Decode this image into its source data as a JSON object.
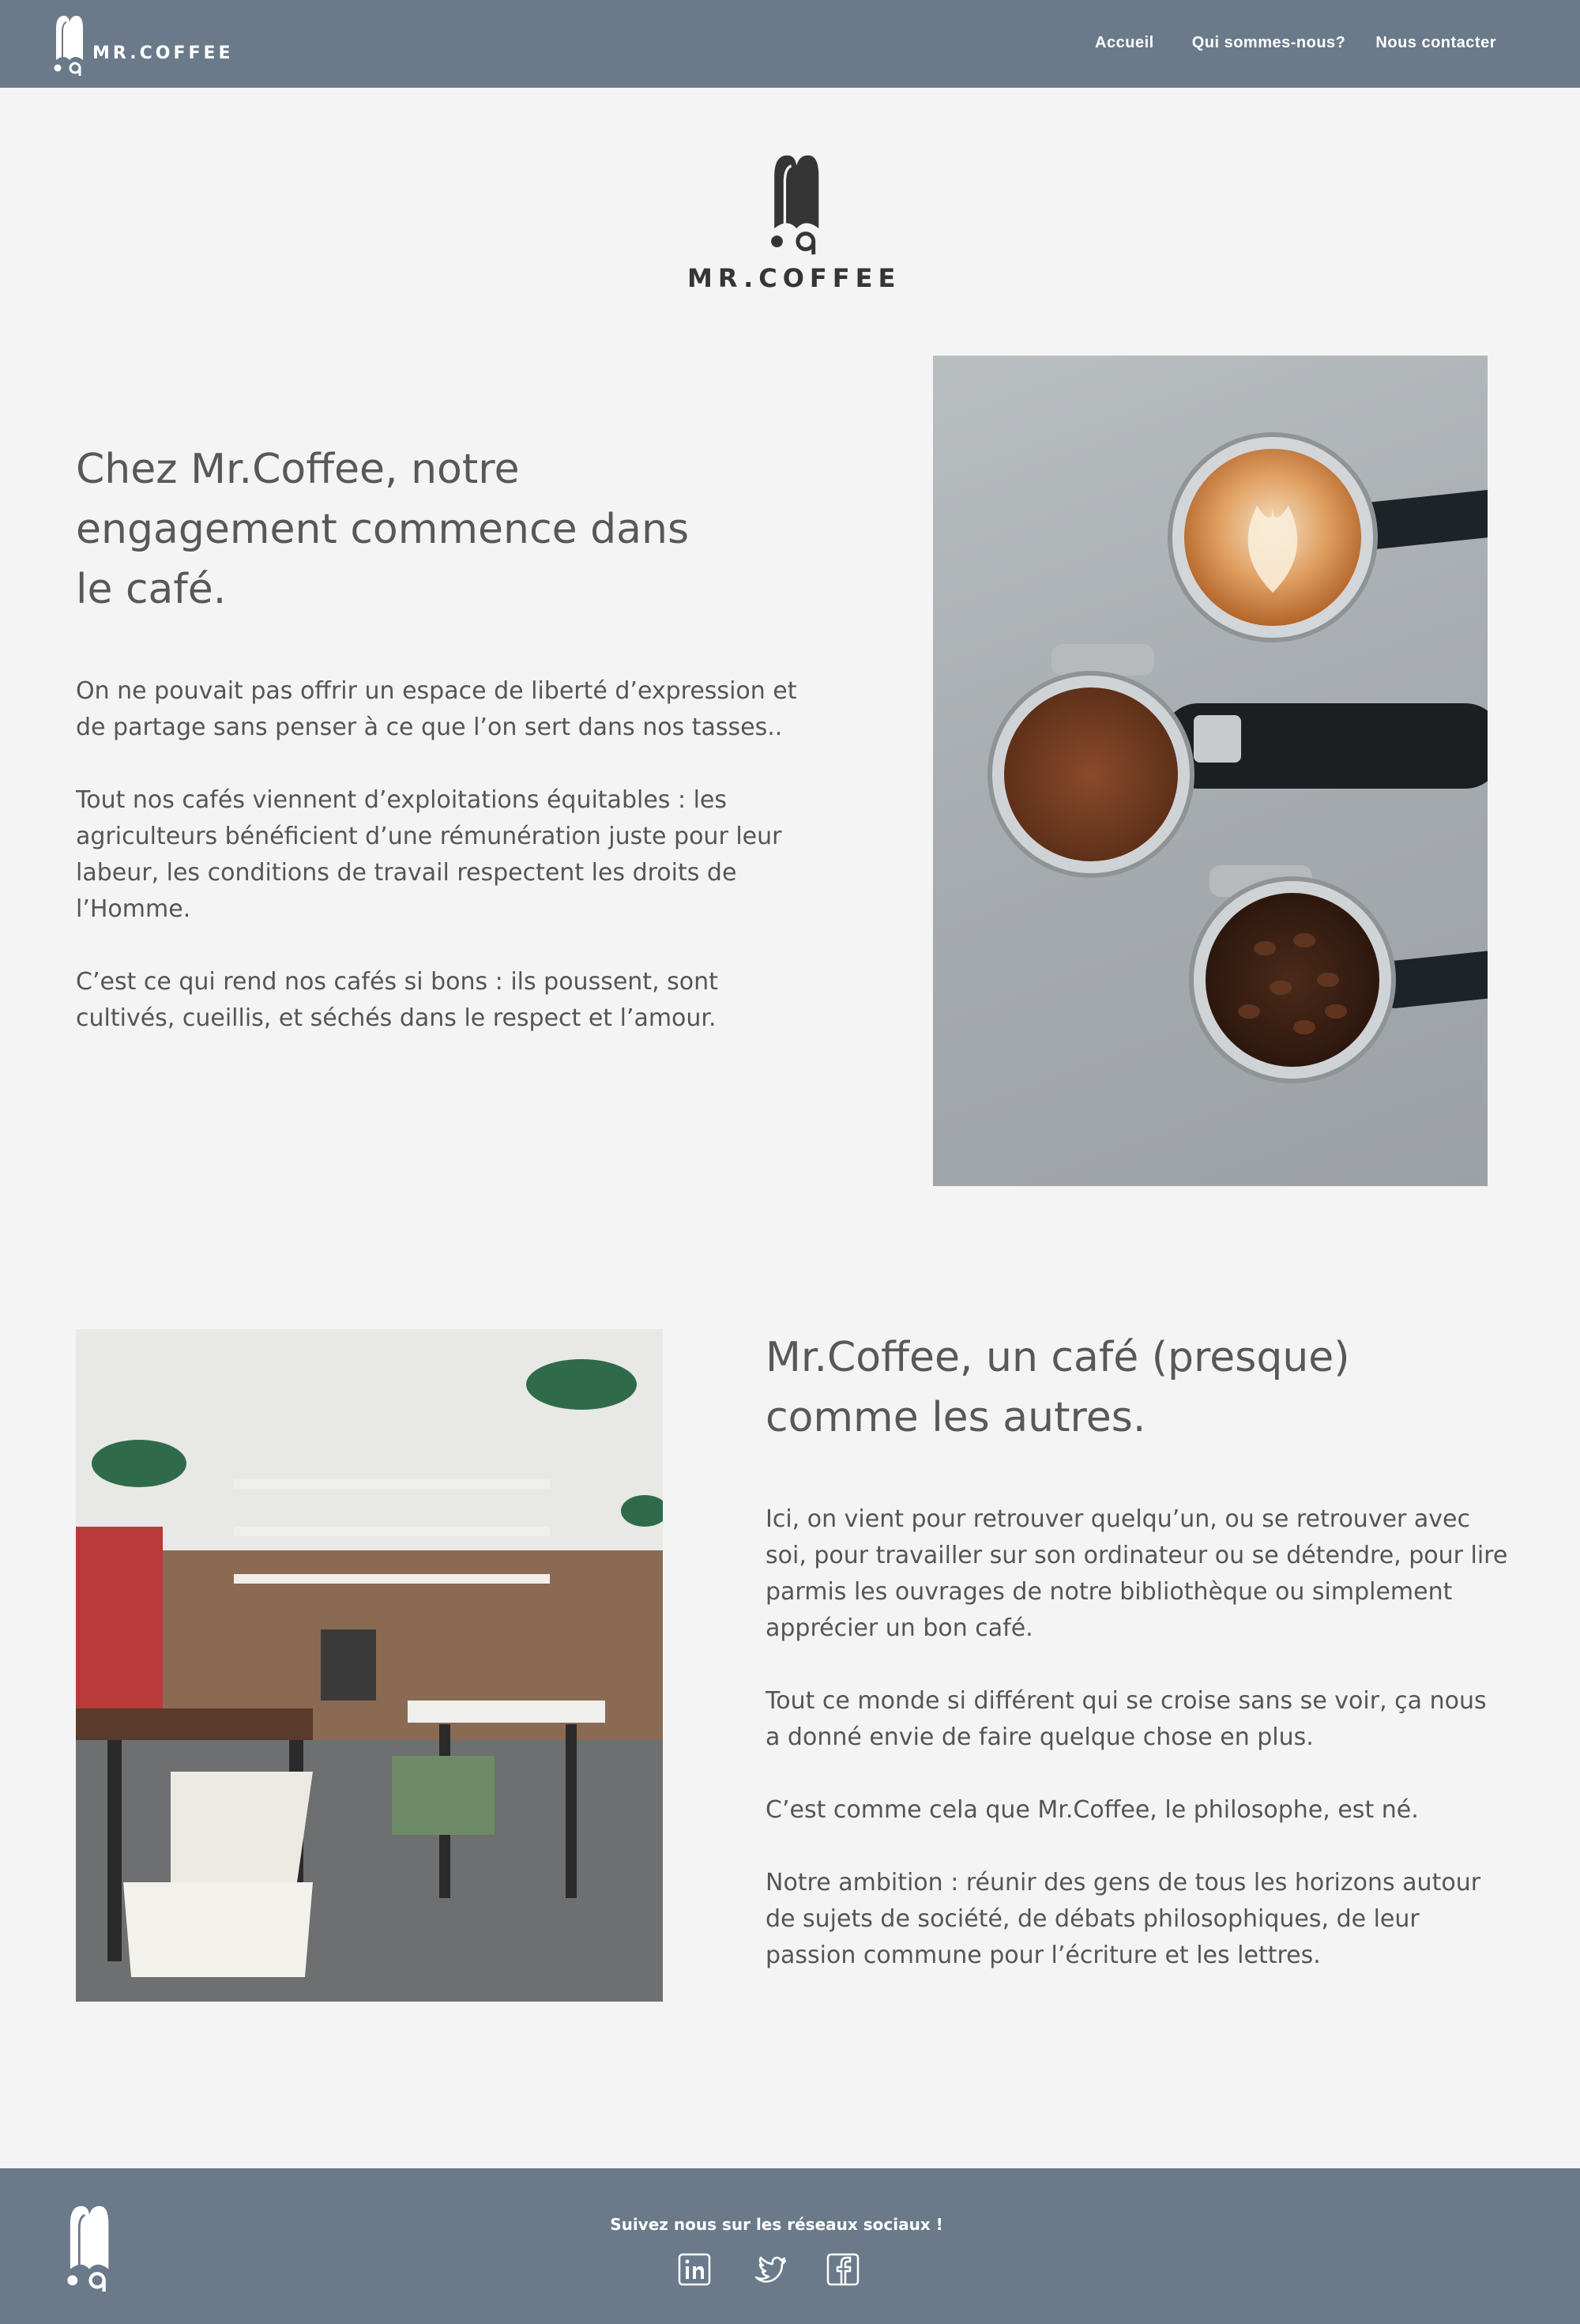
{
  "header": {
    "brand": "MR.COFFEE",
    "nav": [
      {
        "label": "Accueil"
      },
      {
        "label": "Qui sommes-nous?"
      },
      {
        "label": "Nous contacter"
      }
    ]
  },
  "hero": {
    "brand": "MR.COFFEE"
  },
  "section1": {
    "title": "Chez Mr.Coffee, notre engagement commence dans le café.",
    "paragraphs": [
      "On ne pouvait pas offrir un espace de liberté d’expression et de partage sans penser à ce que l’on sert dans nos tasses..",
      "Tout nos cafés viennent d’exploitations équitables : les agriculteurs bénéficient d’une rémunération juste pour leur labeur, les conditions de travail respectent les droits de l’Homme.",
      "C’est ce qui rend nos cafés si bons : ils poussent, sont cultivés, cueillis, et séchés dans le respect et l’amour."
    ]
  },
  "section2": {
    "title": "Mr.Coffee, un café (presque) comme les autres.",
    "paragraphs": [
      "Ici, on vient pour retrouver quelqu’un, ou se retrouver avec soi, pour travailler sur son ordinateur ou se détendre, pour lire parmis les ouvrages de notre bibliothèque ou simplement apprécier un bon café.",
      "Tout ce monde si différent qui se croise sans se voir, ça nous a donné envie de faire quelque chose en plus.",
      "C’est comme cela que Mr.Coffee, le philosophe, est né.",
      "Notre ambition : réunir des gens de tous les horizons autour de sujets de société, de débats philosophiques, de leur passion commune pour l’écriture et les lettres."
    ]
  },
  "footer": {
    "follow": "Suivez nous sur les réseaux sociaux !",
    "socials": [
      {
        "icon": "linkedin-icon"
      },
      {
        "icon": "twitter-icon"
      },
      {
        "icon": "facebook-icon"
      }
    ]
  },
  "colors": {
    "bar": "#6a7a8a",
    "background": "#f4f4f4",
    "text": "#505050"
  }
}
